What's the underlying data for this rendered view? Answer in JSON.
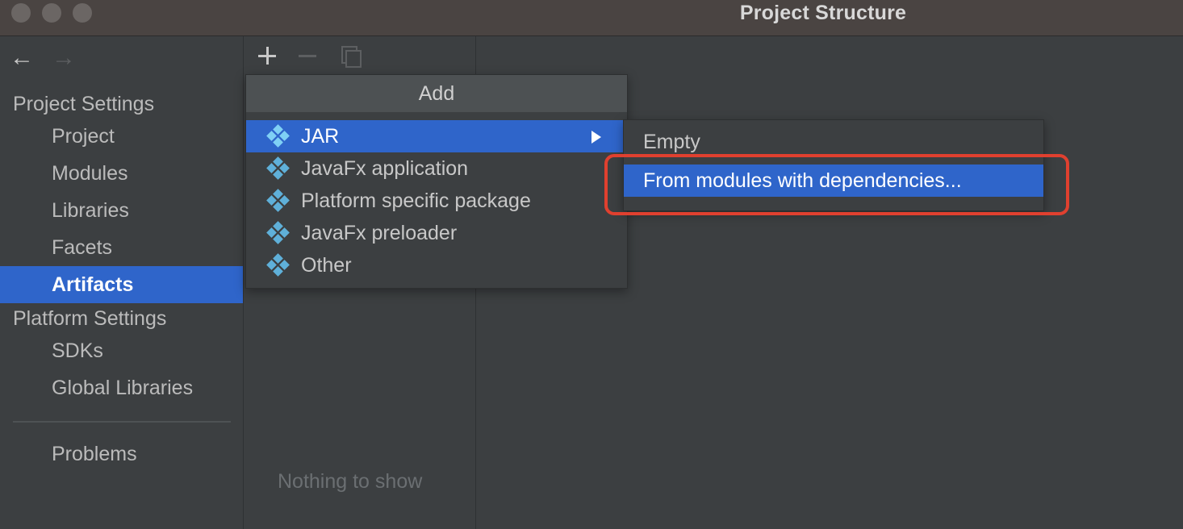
{
  "window": {
    "title": "Project Structure"
  },
  "sidebar": {
    "project_settings_header": "Project Settings",
    "project_items": [
      {
        "label": "Project"
      },
      {
        "label": "Modules"
      },
      {
        "label": "Libraries"
      },
      {
        "label": "Facets"
      },
      {
        "label": "Artifacts",
        "selected": true
      }
    ],
    "platform_settings_header": "Platform Settings",
    "platform_items": [
      {
        "label": "SDKs"
      },
      {
        "label": "Global Libraries"
      }
    ],
    "problems_label": "Problems"
  },
  "middle": {
    "toolbar": {
      "add_icon": "plus-icon",
      "remove_icon": "minus-icon",
      "copy_icon": "copy-icon"
    },
    "empty_text": "Nothing to show"
  },
  "add_popup": {
    "title": "Add",
    "items": [
      {
        "label": "JAR",
        "icon": "artifact-diamond-icon",
        "selected": true,
        "has_submenu": true
      },
      {
        "label": "JavaFx application",
        "icon": "artifact-diamond-icon"
      },
      {
        "label": "Platform specific package",
        "icon": "artifact-diamond-icon"
      },
      {
        "label": "JavaFx preloader",
        "icon": "artifact-diamond-icon"
      },
      {
        "label": "Other",
        "icon": "artifact-diamond-icon"
      }
    ]
  },
  "jar_submenu": {
    "items": [
      {
        "label": "Empty"
      },
      {
        "label": "From modules with dependencies...",
        "selected": true
      }
    ]
  },
  "colors": {
    "selection": "#2f65ca",
    "highlight_border": "#e0402f",
    "background": "#3c3f41",
    "icon_accent": "#5fb0d9"
  }
}
